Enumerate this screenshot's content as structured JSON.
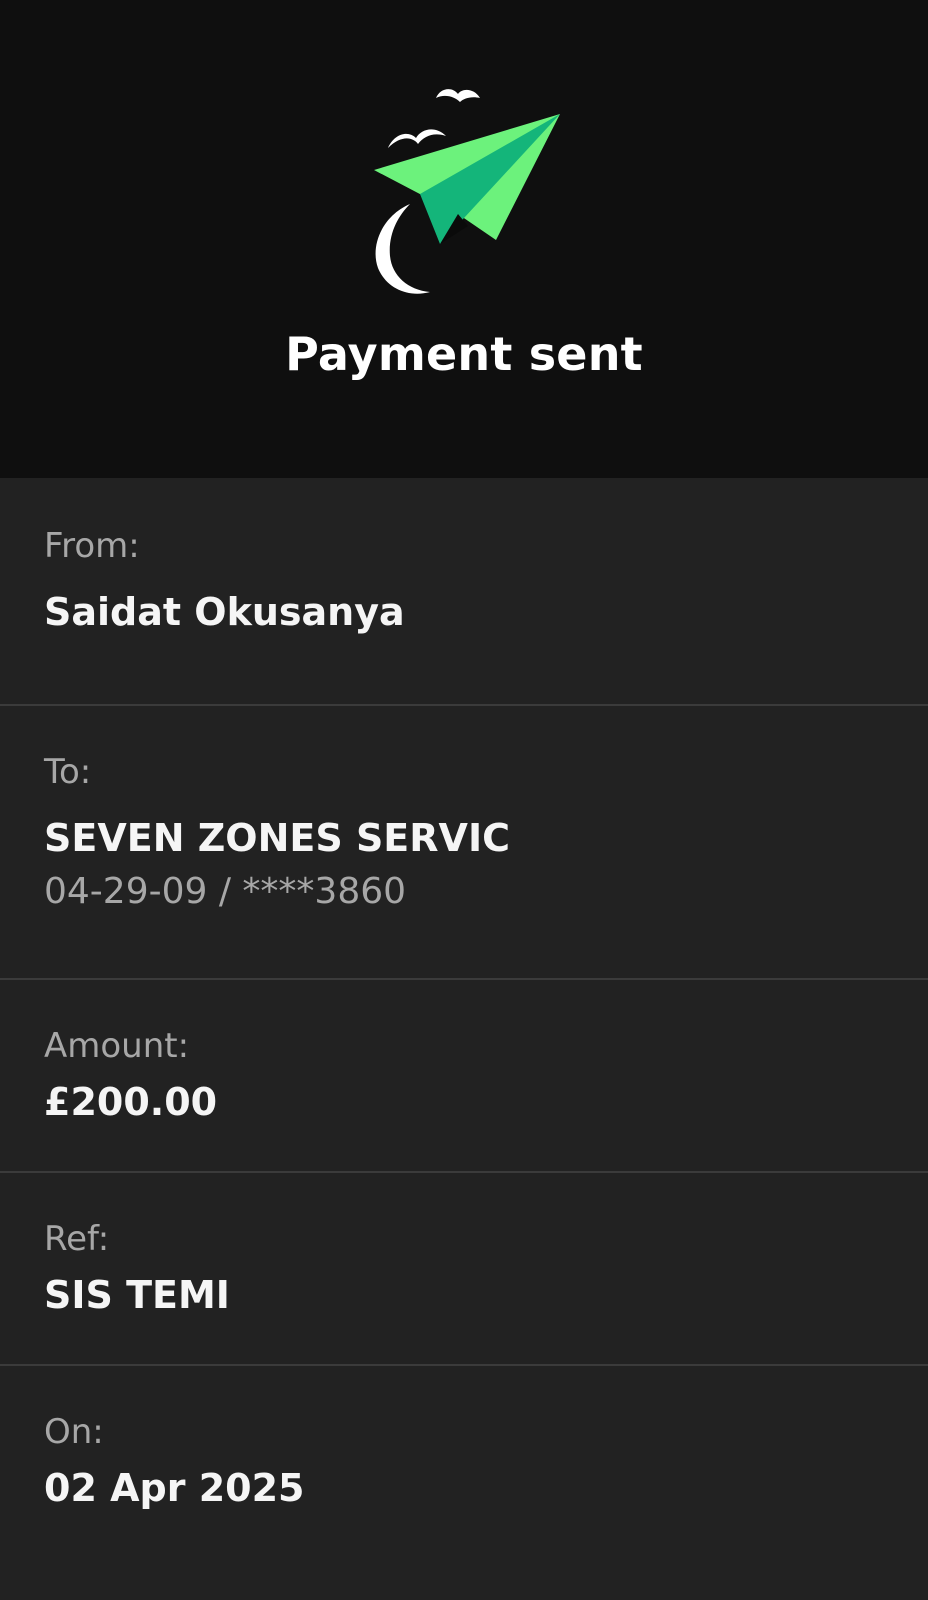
{
  "header": {
    "title": "Payment sent",
    "icon": "paper-plane-icon",
    "accent_color": "#55e07a",
    "accent_dark": "#1daa6a"
  },
  "details": {
    "from": {
      "label": "From:",
      "value": "Saidat Okusanya"
    },
    "to": {
      "label": "To:",
      "value": "SEVEN ZONES SERVIC",
      "account": "04-29-09 / ****3860"
    },
    "amount": {
      "label": "Amount:",
      "value": "£200.00"
    },
    "ref": {
      "label": "Ref:",
      "value": "SIS TEMI"
    },
    "on": {
      "label": "On:",
      "value": "02 Apr 2025"
    }
  }
}
